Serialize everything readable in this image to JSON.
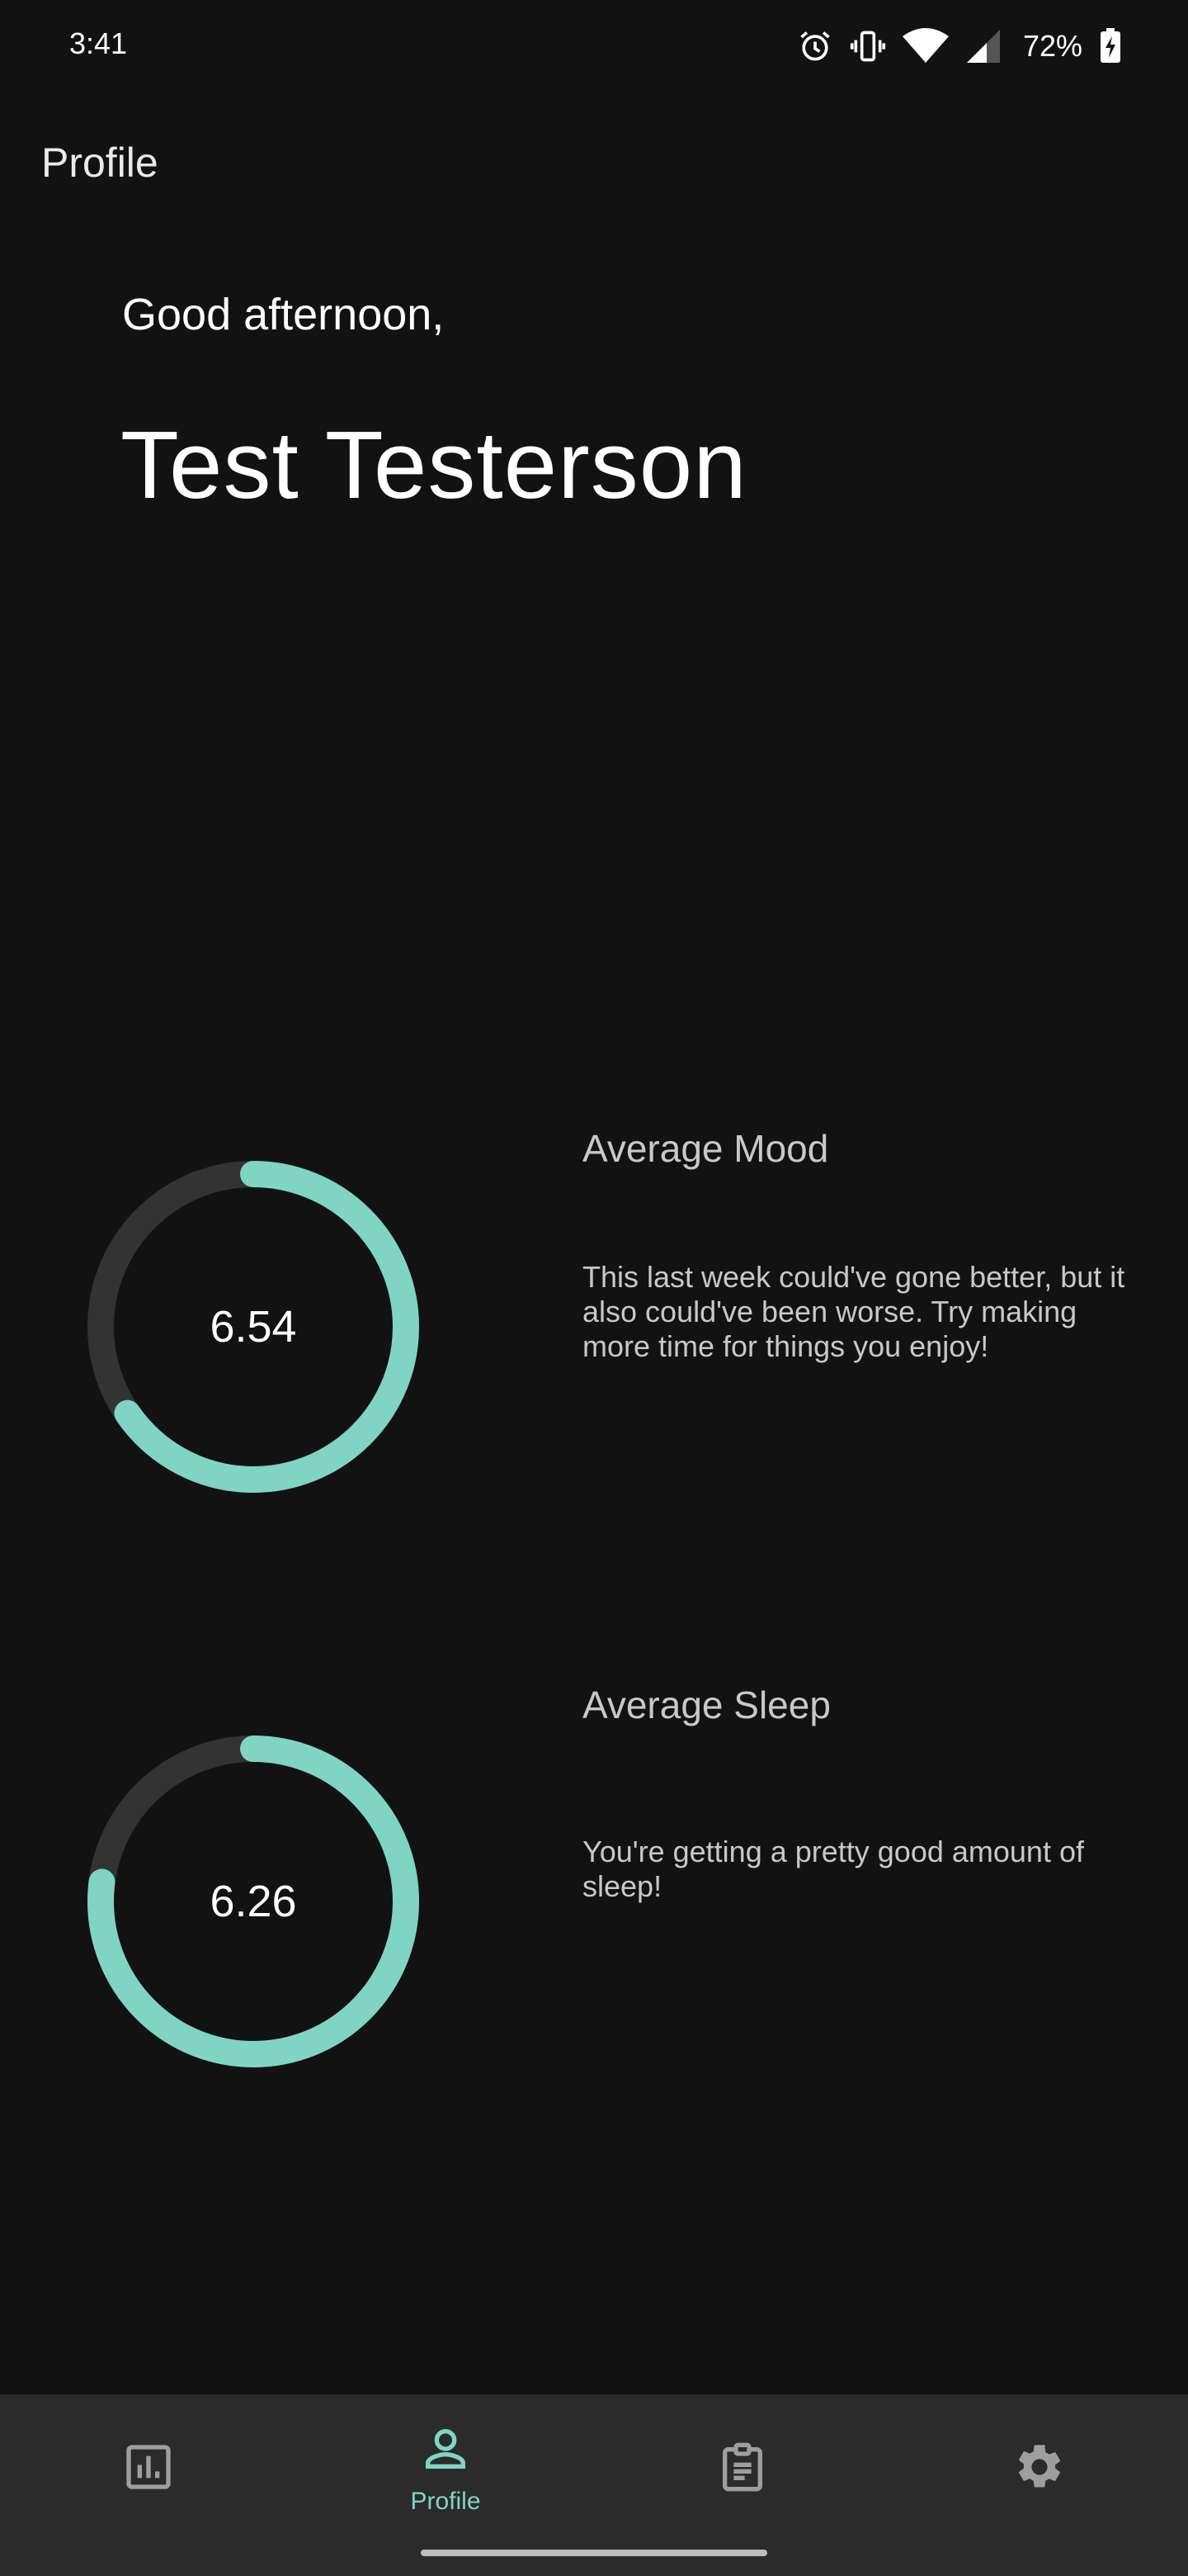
{
  "status_bar": {
    "time": "3:41",
    "battery_percent": "72%",
    "icons": [
      "alarm-icon",
      "vibrate-icon",
      "wifi-icon",
      "cell-signal-icon",
      "battery-charging-icon"
    ]
  },
  "app_bar": {
    "title": "Profile"
  },
  "greeting": {
    "salutation": "Good afternoon,",
    "name": "Test Testerson"
  },
  "stats": [
    {
      "title": "Average Mood",
      "value": "6.54",
      "progress": 0.654,
      "description": "This last week could've gone better, but it also could've been worse. Try making more time for things you enjoy!"
    },
    {
      "title": "Average Sleep",
      "value": "6.26",
      "progress": 0.77,
      "description": "You're getting a pretty good amount of sleep!"
    }
  ],
  "bottom_nav": {
    "items": [
      {
        "icon": "bar-chart-icon",
        "label": ""
      },
      {
        "icon": "person-icon",
        "label": "Profile",
        "active": true
      },
      {
        "icon": "clipboard-icon",
        "label": ""
      },
      {
        "icon": "gear-icon",
        "label": ""
      }
    ]
  },
  "colors": {
    "background": "#121212",
    "accent": "#80d4c4",
    "ring_track": "#333333",
    "nav_background": "#2b2b2b"
  }
}
